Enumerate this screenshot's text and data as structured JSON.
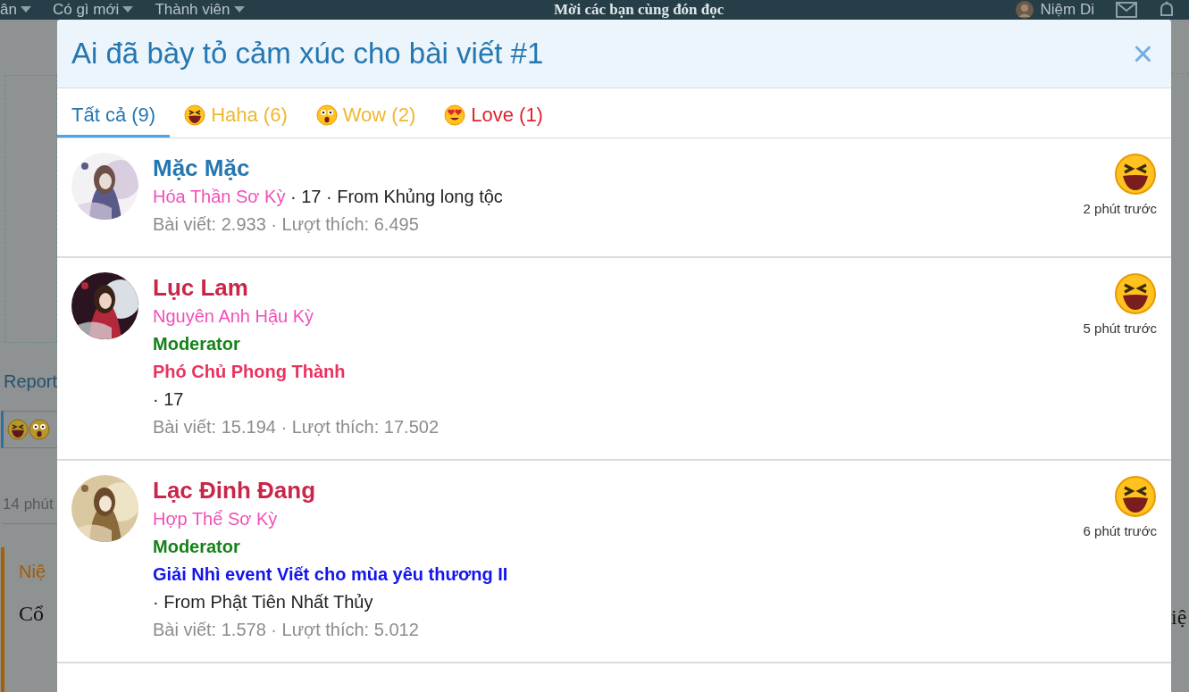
{
  "nav": {
    "items": [
      "ân",
      "Có gì mới",
      "Thành viên"
    ],
    "headline": "Mời các bạn cùng đón đọc",
    "user": "Niệm Di"
  },
  "background": {
    "link": "Report",
    "time": "14 phút",
    "quote_author": "Niệ",
    "quote_text": "Cổ",
    "right_text": "iệ"
  },
  "dialog": {
    "title": "Ai đã bày tỏ cảm xúc cho bài viết #1",
    "close": "×",
    "tabs": [
      {
        "label": "Tất cả (9)",
        "kind": "all",
        "color": "#2577b1",
        "selected": true
      },
      {
        "label": "Haha (6)",
        "kind": "haha",
        "color": "#f0b72f",
        "selected": false
      },
      {
        "label": "Wow (2)",
        "kind": "wow",
        "color": "#f0b72f",
        "selected": false
      },
      {
        "label": "Love (1)",
        "kind": "love",
        "color": "#e0242f",
        "selected": false
      }
    ]
  },
  "users": [
    {
      "name": "Mặc Mặc",
      "color": "#2577b1",
      "rank": "Hóa Thần Sơ Kỳ",
      "meta": "· 17 · From Khủng long tộc",
      "stats": "Bài viết: 2.933 · Lượt thích: 6.495",
      "kind": "haha",
      "time": "2 phút trước"
    },
    {
      "name": "Lục Lam",
      "color": "#c9264a",
      "rank": "Nguyên Anh Hậu Kỳ",
      "banners": [
        {
          "text": "Moderator",
          "color": "#15821a"
        },
        {
          "text": "Phó Chủ Phong Thành",
          "color": "#e8335e"
        }
      ],
      "meta": "· 17",
      "stats": "Bài viết: 15.194 · Lượt thích: 17.502",
      "kind": "haha",
      "time": "5 phút trước"
    },
    {
      "name": "Lạc Đinh Đang",
      "color": "#c9264a",
      "rank": "Hợp Thể Sơ Kỳ",
      "banners": [
        {
          "text": "Moderator",
          "color": "#15821a"
        },
        {
          "text": "Giải Nhì event Viết cho mùa yêu thương II",
          "color": "#1414ee"
        }
      ],
      "meta": "· From Phật Tiên Nhất Thủy",
      "stats": "Bài viết: 1.578 · Lượt thích: 5.012",
      "kind": "haha",
      "time": "6 phút trước"
    }
  ]
}
